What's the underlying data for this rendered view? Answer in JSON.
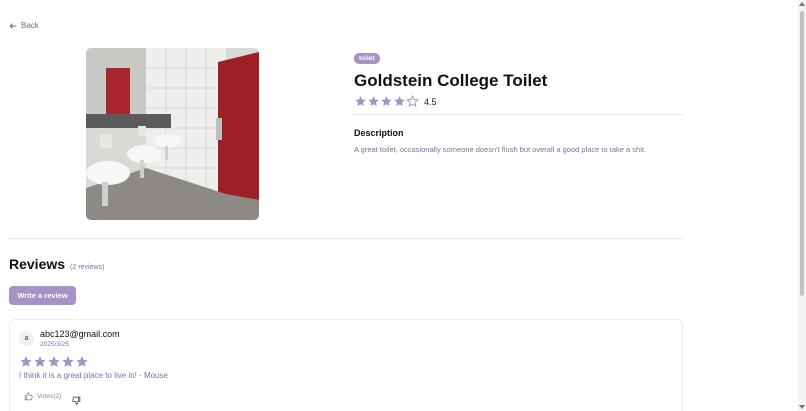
{
  "nav": {
    "back_label": "Back"
  },
  "place": {
    "tag": "toilet",
    "title": "Goldstein College Toilet",
    "rating": 4.5,
    "rating_text": "4.5",
    "photo_icon": "restroom-photo",
    "description_heading": "Description",
    "description": "A great toilet, occasionally someone doesn't flush but overall a good place to take a shit."
  },
  "reviews": {
    "heading": "Reviews",
    "count_text": "(2 reviews)",
    "write_label": "Write a review",
    "items": [
      {
        "avatar": "a",
        "email": "abc123@gmail.com",
        "date": "2025/3/25",
        "stars": 5,
        "comment": "I think it is a great place to live in! - Mouse",
        "votes_label": "Votes(2)"
      }
    ]
  },
  "colors": {
    "accent": "#a493c4",
    "accent_text": "#7d6fa8",
    "star": "#a493c4"
  }
}
